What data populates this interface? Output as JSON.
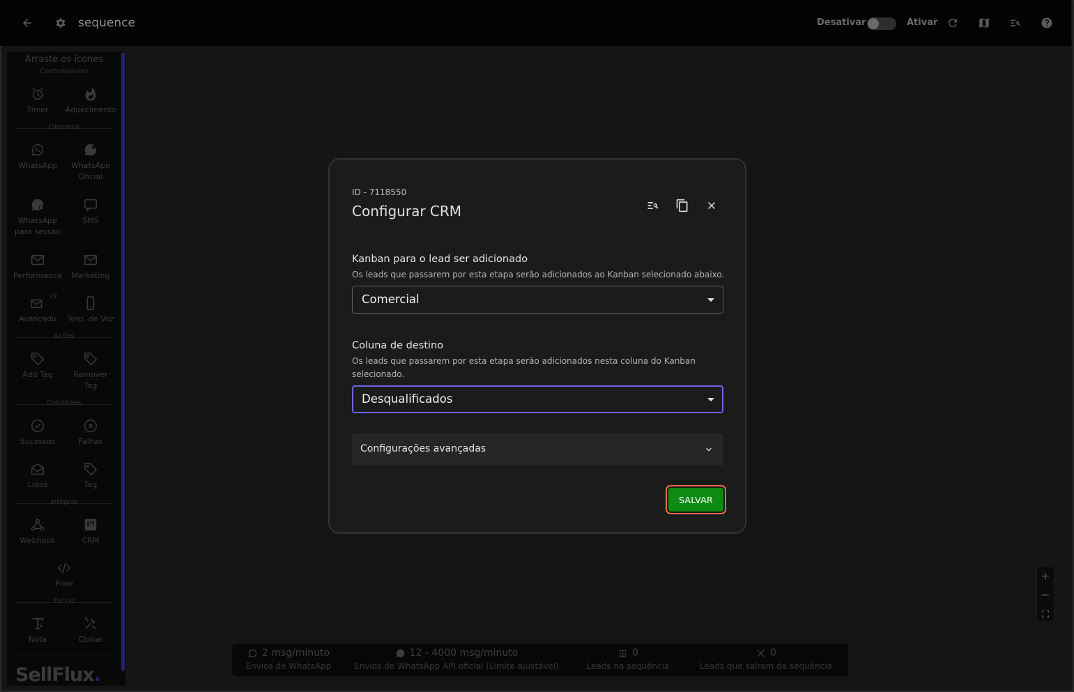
{
  "header": {
    "title": "sequence",
    "deactivate_label": "Desativar",
    "activate_label": "Ativar"
  },
  "sidebar": {
    "heading": "Arraste os ícones",
    "sections": {
      "controladores": "Controladores",
      "disparos": "Disparos",
      "acoes": "Ações",
      "condicoes": "Condições",
      "integrar": "Integrar",
      "extras": "Extras"
    },
    "items": {
      "timer": "Timer",
      "aquecimento": "Aquecimento",
      "whatsapp": "WhatsApp",
      "whatsapp_oficial_1": "WhatsApp",
      "whatsapp_oficial_2": "Oficial",
      "whatsapp_sessao_1": "WhatsApp",
      "whatsapp_sessao_2": "para sessão",
      "sms": "SMS",
      "performance": "Performance",
      "marketing": "Marketing",
      "avancado": "Avançado",
      "avancado_badge": "v2",
      "torp_voz": "Torp. de Voz",
      "add_tag": "Add Tag",
      "remover_tag_1": "Remover",
      "remover_tag_2": "Tag",
      "sucessos": "Sucessos",
      "falhas": "Falhas",
      "lidos": "Lidos",
      "tag": "Tag",
      "webhook": "Webhook",
      "crm": "CRM",
      "pixel": "Pixel",
      "nota": "Nota",
      "clonar": "Clonar"
    },
    "brand": "SellFlux",
    "brand_dot": "."
  },
  "stats": [
    {
      "value": "2 msg/minuto",
      "label": "Envios de WhatsApp"
    },
    {
      "value": "12 - 4000 msg/minuto",
      "label": "Envios de WhatsApp API oficial (Limite ajustável)"
    },
    {
      "value": "0",
      "label": "Leads na sequência"
    },
    {
      "value": "0",
      "label": "Leads que saíram da sequência"
    }
  ],
  "zoom": {
    "in": "+",
    "out": "−"
  },
  "modal": {
    "id_text": "ID - 7118550",
    "title": "Configurar CRM",
    "kanban": {
      "label": "Kanban para o lead ser adicionado",
      "help": "Os leads que passarem por esta etapa serão adicionados ao Kanban selecionado abaixo.",
      "value": "Comercial"
    },
    "column": {
      "label": "Coluna de destino",
      "help": "Os leads que passarem por esta etapa serão adicionados nesta coluna do Kanban selecionado.",
      "value": "Desqualificados"
    },
    "advanced_label": "Configurações avançadas",
    "save_label": "SALVAR"
  }
}
